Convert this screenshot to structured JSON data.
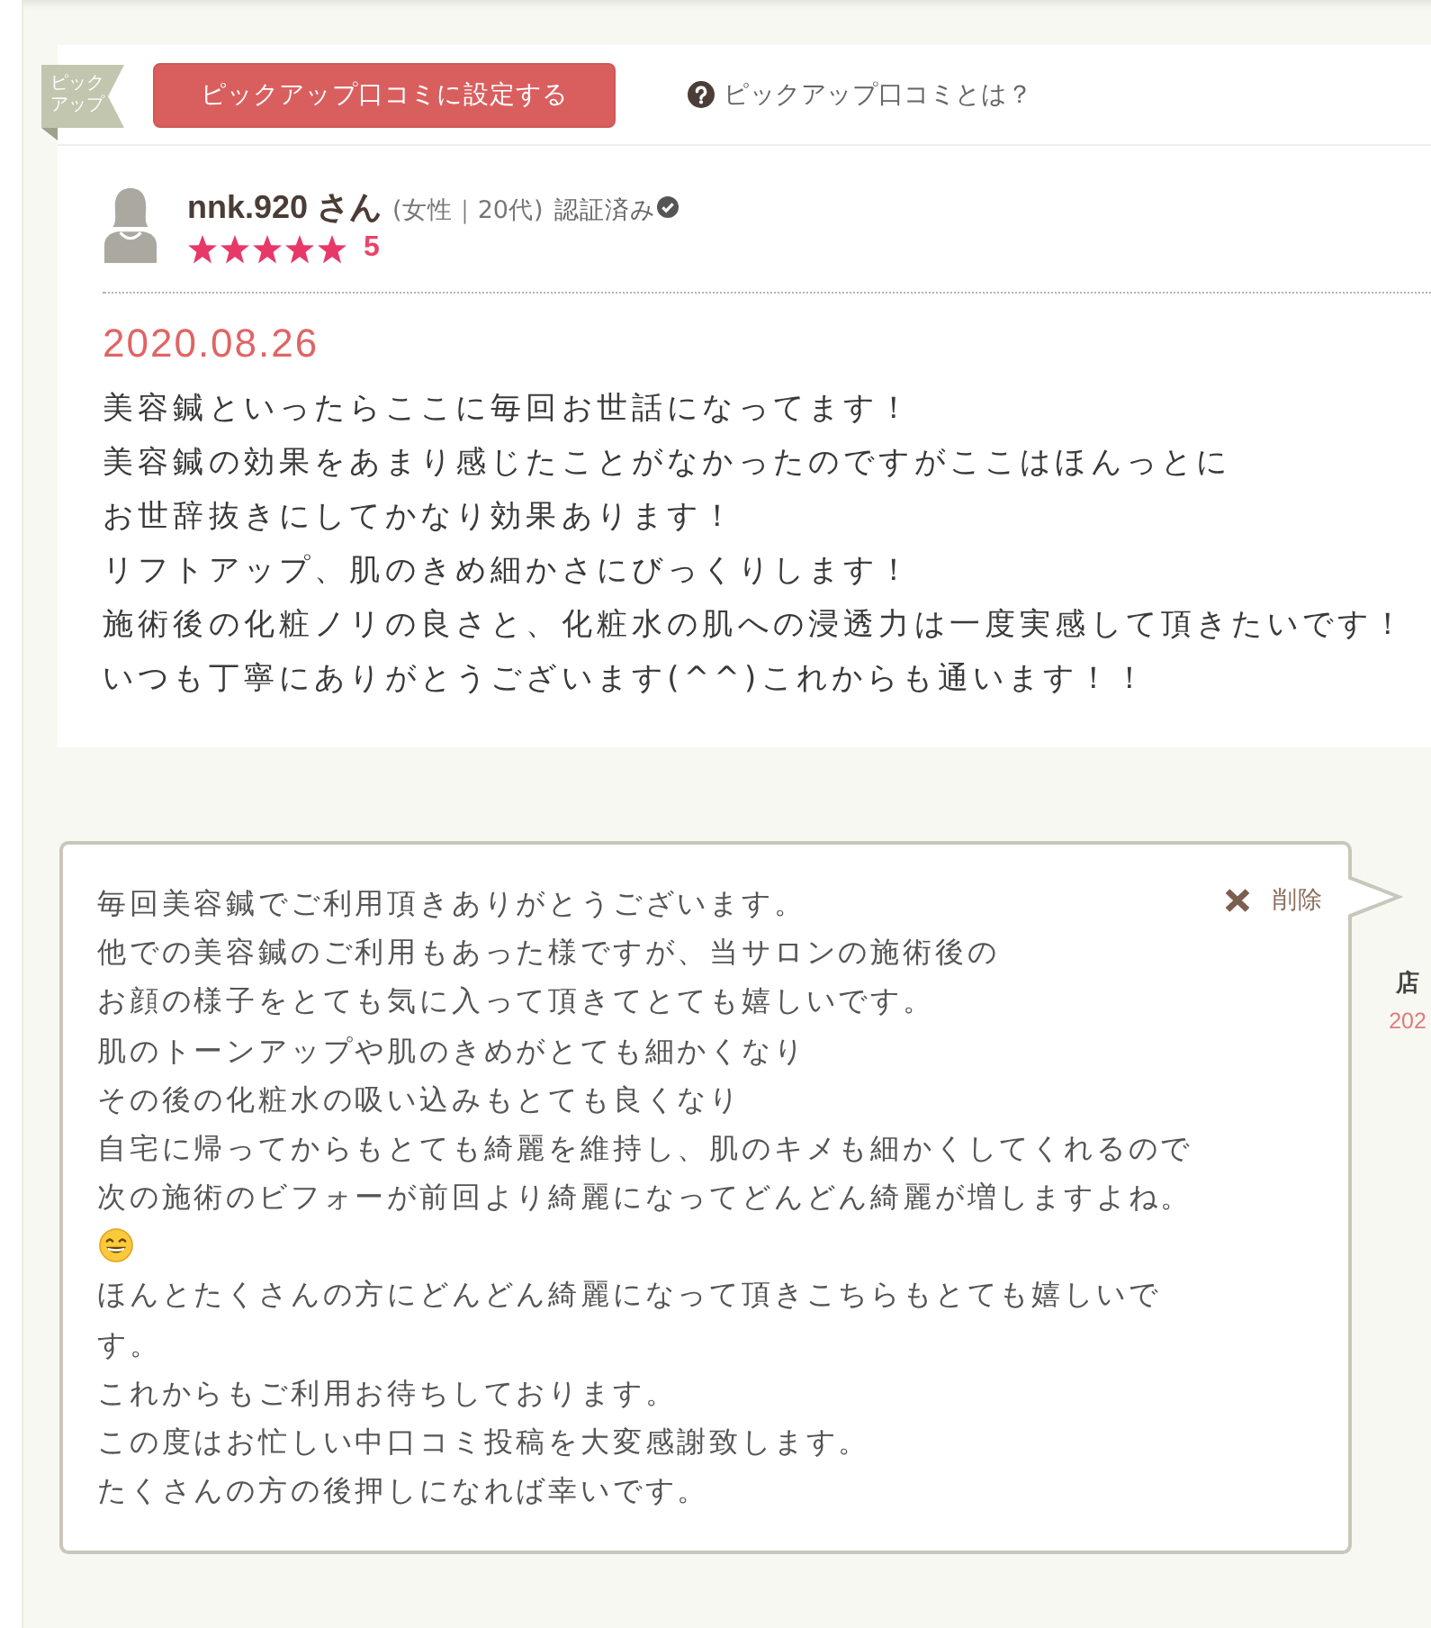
{
  "pickup_bar": {
    "badge_lines": [
      "ピック",
      "アップ"
    ],
    "set_button": "ピックアップ口コミに設定する",
    "help_link": "ピックアップ口コミとは？"
  },
  "review": {
    "reviewer": {
      "name": "nnk.920 さん",
      "profile": "(女性｜20代)",
      "verified": "認証済み",
      "stars": 5,
      "rating": "5"
    },
    "date": "2020.08.26",
    "lines": [
      "美容鍼といったらここに毎回お世話になってます！",
      "美容鍼の効果をあまり感じたことがなかったのですがここはほんっとに",
      "お世辞抜きにしてかなり効果あります！",
      "リフトアップ、肌のきめ細かさにびっくりします！",
      "施術後の化粧ノリの良さと、化粧水の肌への浸透力は一度実感して頂きたいです！",
      "いつも丁寧にありがとうございます(^^)これからも通います！！"
    ]
  },
  "reply": {
    "delete": "削除",
    "blocks": [
      {
        "kind": "text",
        "lines": [
          "毎回美容鍼でご利用頂きありがとうございます。",
          "他での美容鍼のご利用もあった様ですが、当サロンの施術後の",
          "お顔の様子をとても気に入って頂きてとても嬉しいです。",
          "肌のトーンアップや肌のきめがとても細かくなり",
          "その後の化粧水の吸い込みもとても良くなり",
          "自宅に帰ってからもとても綺麗を維持し、肌のキメも細かくしてくれるので",
          "次の施術のビフォーが前回より綺麗になってどんどん綺麗が増しますよね。"
        ]
      },
      {
        "kind": "emoji"
      },
      {
        "kind": "text",
        "lines": [
          "ほんとたくさんの方にどんどん綺麗になって頂きこちらもとても嬉しいで",
          "す。",
          "これからもご利用お待ちしております。",
          "この度はお忙しい中口コミ投稿を大変感謝致します。",
          "たくさんの方の後押しになれば幸いです。"
        ]
      }
    ]
  },
  "shop": {
    "label": "店",
    "date": "202"
  }
}
